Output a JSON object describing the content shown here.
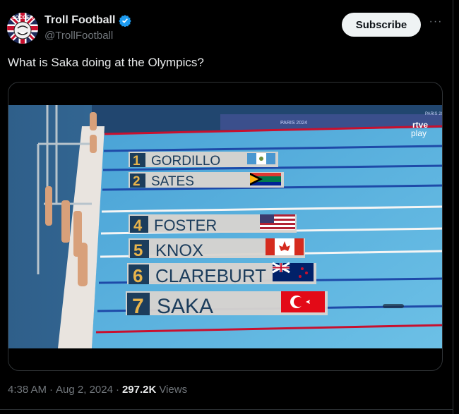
{
  "account": {
    "display_name": "Troll Football",
    "handle": "@TrollFootball",
    "avatar_text": "SOCCER",
    "verified_icon": "verified-badge-icon"
  },
  "actions": {
    "subscribe_label": "Subscribe",
    "more_icon": "more-options-icon",
    "more_label": "···"
  },
  "tweet": {
    "text": "What is Saka doing at the Olympics?"
  },
  "video": {
    "broadcast_logo": [
      "rtve",
      "play"
    ],
    "banner_text": "PARIS 2024",
    "lanes": [
      {
        "number": "1",
        "name": "GORDILLO",
        "flag": "Guatemala"
      },
      {
        "number": "2",
        "name": "SATES",
        "flag": "South Africa"
      },
      {
        "number": "4",
        "name": "FOSTER",
        "flag": "United States"
      },
      {
        "number": "5",
        "name": "KNOX",
        "flag": "Canada"
      },
      {
        "number": "6",
        "name": "CLAREBURT",
        "flag": "New Zealand"
      },
      {
        "number": "7",
        "name": "SAKA",
        "flag": "Turkey"
      }
    ]
  },
  "meta": {
    "time": "4:38 AM",
    "separator1": "·",
    "date": "Aug 2, 2024",
    "separator2": "·",
    "views_count": "297.2K",
    "views_label": "Views"
  },
  "colors": {
    "background": "#000000",
    "text_primary": "#e7e9ea",
    "text_secondary": "#71767b",
    "verified_blue": "#1d9bf0",
    "pool_water": "#5fb0d8",
    "lane_plate": "#d9d4cf",
    "lane_number_bg": "#1c3d5c",
    "lane_number_fg": "#e8b44c"
  }
}
